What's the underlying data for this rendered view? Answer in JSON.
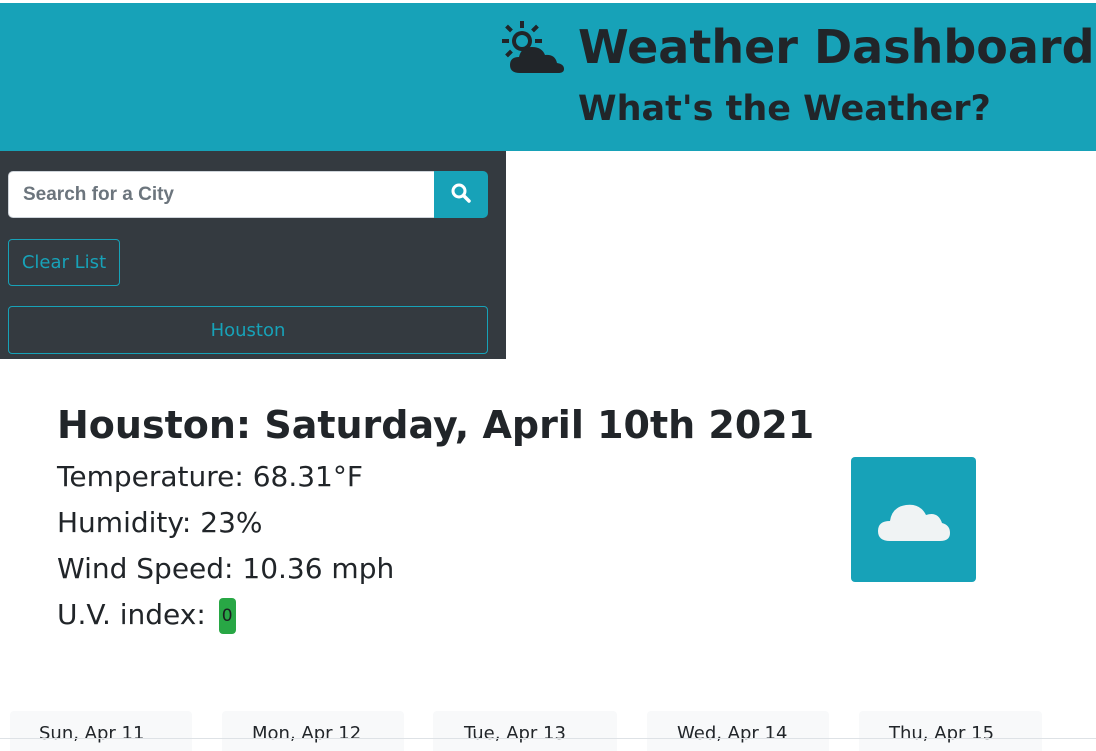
{
  "header": {
    "title": "Weather Dashboard",
    "subtitle": "What's the Weather?",
    "icon": "sun-behind-cloud-icon"
  },
  "sidebar": {
    "search": {
      "placeholder": "Search for a City",
      "value": "",
      "icon": "search-icon"
    },
    "clear_label": "Clear List",
    "history": [
      "Houston"
    ]
  },
  "current": {
    "heading": "Houston: Saturday, April 10th 2021",
    "temperature": "Temperature: 68.31°F",
    "humidity": "Humidity: 23%",
    "wind": "Wind Speed: 10.36 mph",
    "uv_label": "U.V. index:",
    "uv_value": "0",
    "uv_color": "#28a745",
    "icon": "cloud-icon"
  },
  "forecast": [
    {
      "date": "Sun, Apr 11"
    },
    {
      "date": "Mon, Apr 12"
    },
    {
      "date": "Tue, Apr 13"
    },
    {
      "date": "Wed, Apr 14"
    },
    {
      "date": "Thu, Apr 15"
    }
  ],
  "colors": {
    "accent": "#17a2b8",
    "sidebar": "#343a40",
    "uv_good": "#28a745"
  }
}
